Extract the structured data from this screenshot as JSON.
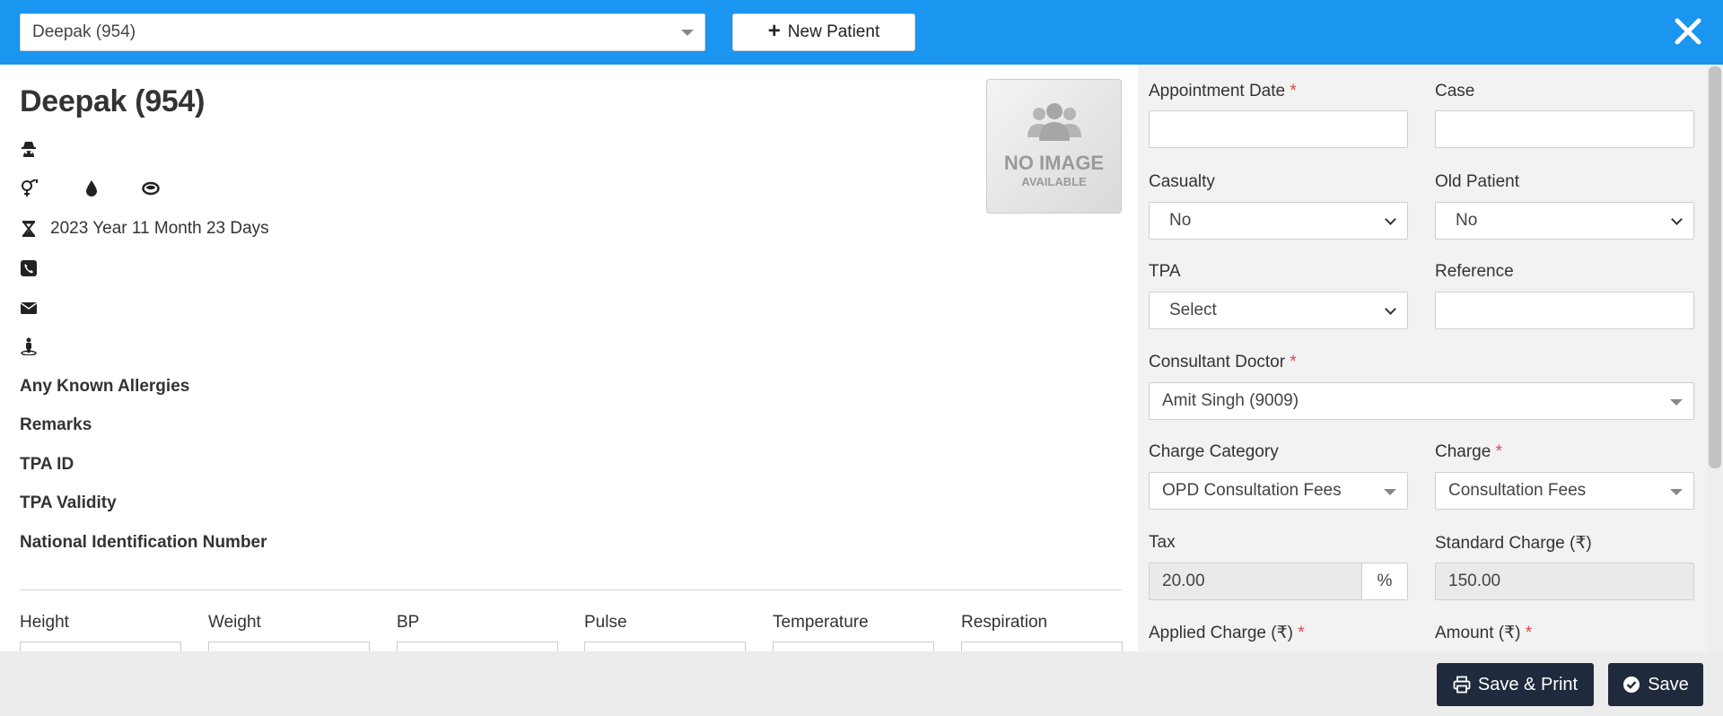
{
  "header": {
    "patient_select_value": "Deepak (954)",
    "new_patient_label": "New Patient"
  },
  "patient": {
    "name": "Deepak (954)",
    "age": "2023 Year 11 Month 23 Days",
    "photo_text_line1": "NO IMAGE",
    "photo_text_line2": "AVAILABLE",
    "labels": {
      "allergies": "Any Known Allergies",
      "remarks": "Remarks",
      "tpa_id": "TPA ID",
      "tpa_validity": "TPA Validity",
      "national_id": "National Identification Number"
    }
  },
  "vitals": {
    "labels": [
      "Height",
      "Weight",
      "BP",
      "Pulse",
      "Temperature",
      "Respiration"
    ]
  },
  "form": {
    "appointment_date": {
      "label": "Appointment Date",
      "value": ""
    },
    "case": {
      "label": "Case",
      "value": ""
    },
    "casualty": {
      "label": "Casualty",
      "value": "No"
    },
    "old_patient": {
      "label": "Old Patient",
      "value": "No"
    },
    "tpa": {
      "label": "TPA",
      "value": "Select"
    },
    "reference": {
      "label": "Reference",
      "value": ""
    },
    "consultant_doctor": {
      "label": "Consultant Doctor",
      "value": "Amit Singh (9009)"
    },
    "charge_category": {
      "label": "Charge Category",
      "value": "OPD Consultation Fees"
    },
    "charge": {
      "label": "Charge",
      "value": "Consultation Fees"
    },
    "tax": {
      "label": "Tax",
      "value": "20.00",
      "unit": "%"
    },
    "standard_charge": {
      "label": "Standard Charge (₹)",
      "value": "150.00"
    },
    "applied_charge": {
      "label": "Applied Charge (₹)"
    },
    "amount": {
      "label": "Amount (₹)"
    },
    "required_mark": "*"
  },
  "footer": {
    "save_print_label": "Save & Print",
    "save_label": "Save"
  },
  "colors": {
    "header_blue": "#1a95f0",
    "footer_button": "#1f2a3c",
    "required": "#e04848"
  }
}
